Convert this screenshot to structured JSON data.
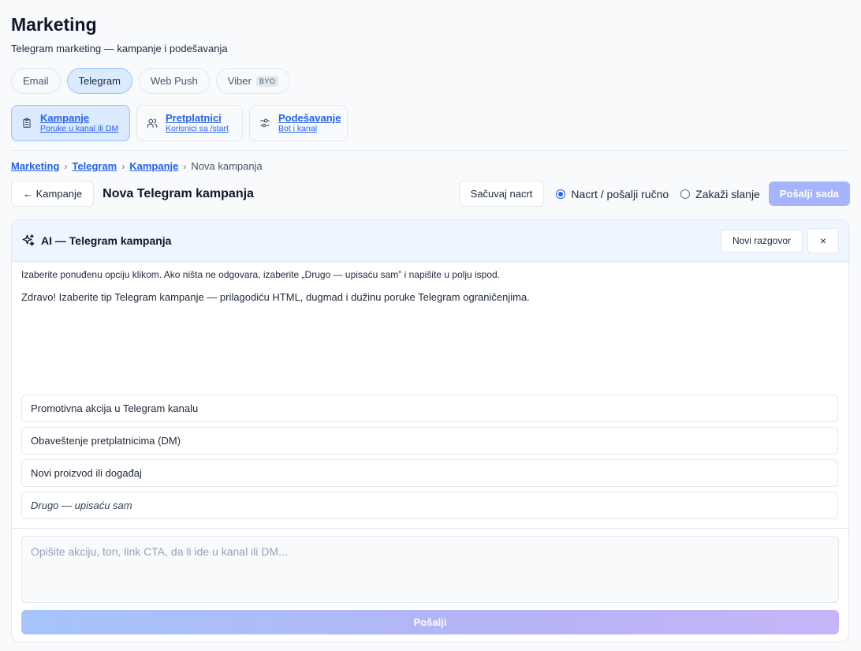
{
  "page": {
    "title": "Marketing",
    "subtitle": "Telegram marketing — kampanje i podešavanja"
  },
  "channel_tabs": [
    {
      "label": "Email",
      "active": false
    },
    {
      "label": "Telegram",
      "active": true
    },
    {
      "label": "Web Push",
      "active": false
    },
    {
      "label": "Viber",
      "badge": "BYO",
      "active": false
    }
  ],
  "section_tabs": [
    {
      "title": "Kampanje",
      "subtitle": "Poruke u kanal ili DM",
      "icon": "clipboard-icon",
      "active": true
    },
    {
      "title": "Pretplatnici",
      "subtitle": "Korisnici sa /start",
      "icon": "users-icon",
      "active": false
    },
    {
      "title": "Podešavanje",
      "subtitle": "Bot i kanal",
      "icon": "sliders-icon",
      "active": false
    }
  ],
  "breadcrumb": {
    "items": [
      "Marketing",
      "Telegram",
      "Kampanje"
    ],
    "current": "Nova kampanja"
  },
  "toolbar": {
    "back_label": "← Kampanje",
    "title": "Nova Telegram kampanja",
    "save_draft_label": "Sačuvaj nacrt",
    "radio_manual_label": "Nacrt / pošalji ručno",
    "radio_schedule_label": "Zakaži slanje",
    "radio_selected": "manual",
    "send_now_label": "Pošalji sada"
  },
  "ai_panel": {
    "title": "AI — Telegram kampanja",
    "new_chat_label": "Novi razgovor",
    "close_label": "×",
    "hint": "Izaberite ponuđenu opciju klikom. Ako ništa ne odgovara, izaberite „Drugo — upisaću sam” i napišite u polju ispod.",
    "message": "Zdravo! Izaberite tip Telegram kampanje — prilagodiću HTML, dugmad i dužinu poruke Telegram ograničenjima.",
    "options": [
      "Promotivna akcija u Telegram kanalu",
      "Obaveštenje pretplatnicima (DM)",
      "Novi proizvod ili događaj",
      "Drugo — upisaću sam"
    ],
    "input_placeholder": "Opišite akciju, ton, link CTA, da li ide u kanal ili DM...",
    "send_label": "Pošalji"
  },
  "colors": {
    "accent": "#2563eb",
    "active_bg": "#dbeafe",
    "send_now_disabled": "#a5b4fc"
  }
}
